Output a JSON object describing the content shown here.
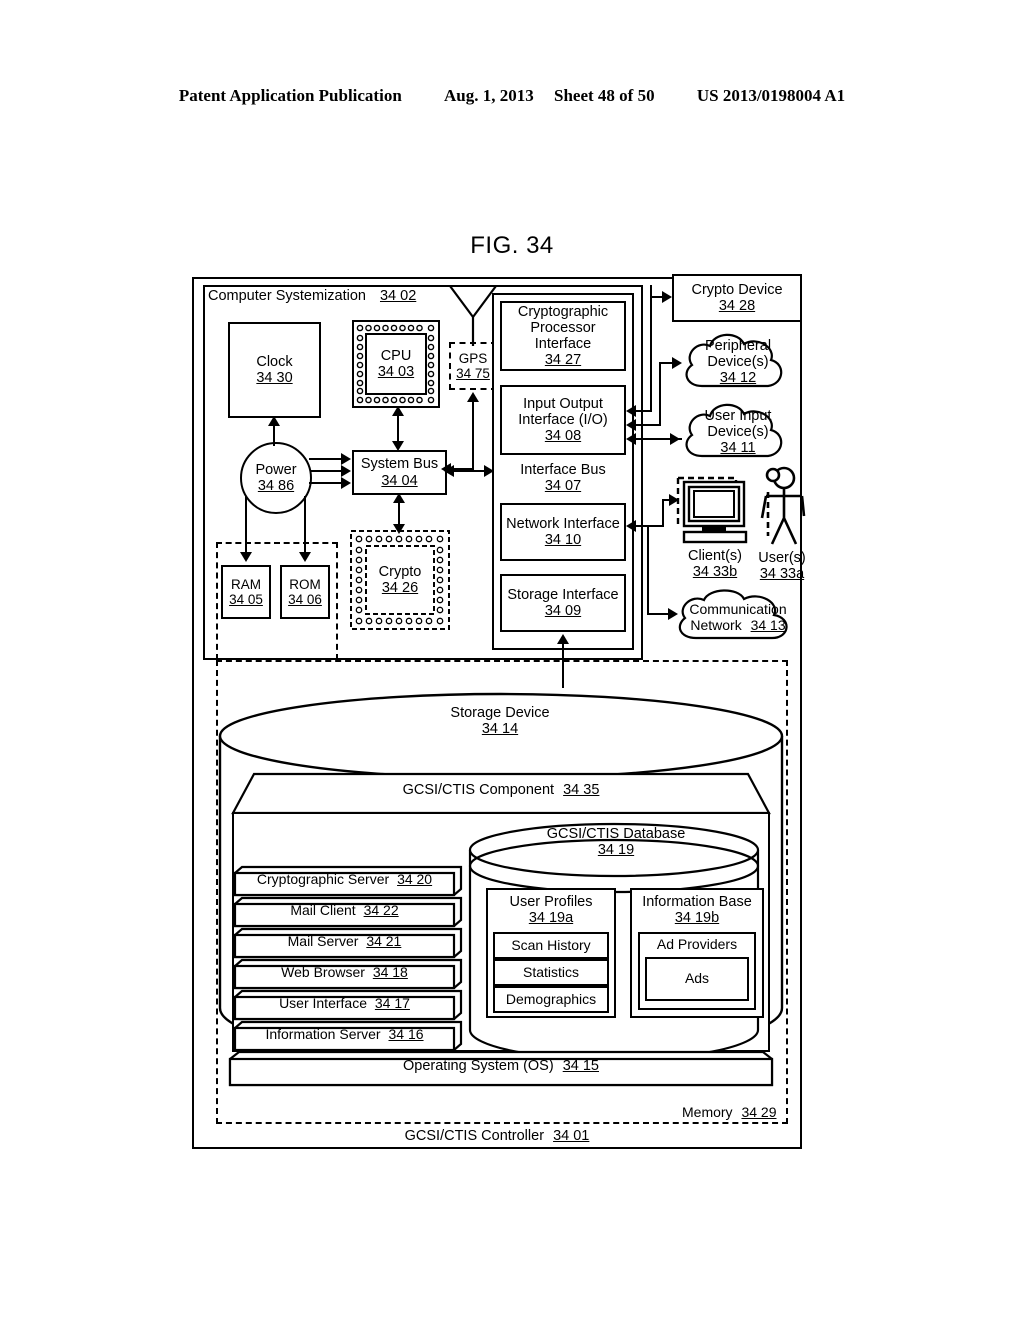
{
  "header": {
    "publication": "Patent Application Publication",
    "date": "Aug. 1, 2013",
    "sheet": "Sheet 48 of 50",
    "patent_number": "US 2013/0198004 A1"
  },
  "figure": {
    "title": "FIG. 34"
  },
  "diagram": {
    "outer_label": "GCSI/CTIS Controller",
    "outer_ref": "34 01",
    "systemization": {
      "label": "Computer Systemization",
      "ref": "34 02"
    },
    "clock": {
      "label": "Clock",
      "ref": "34 30"
    },
    "cpu": {
      "label": "CPU",
      "ref": "34 03"
    },
    "gps": {
      "label": "GPS",
      "ref": "34 75"
    },
    "power": {
      "label": "Power",
      "ref": "34 86"
    },
    "sysbus": {
      "label": "System Bus",
      "ref": "34 04"
    },
    "ram": {
      "label": "RAM",
      "ref": "34 05"
    },
    "rom": {
      "label": "ROM",
      "ref": "34 06"
    },
    "crypto_chip": {
      "label": "Crypto",
      "ref": "34 26"
    },
    "crypto_proc_interface": {
      "line1": "Cryptographic",
      "line2": "Processor Interface",
      "ref": "34 27"
    },
    "io_interface": {
      "line1": "Input Output",
      "line2": "Interface (I/O)",
      "ref": "34 08"
    },
    "interface_bus": {
      "label": "Interface Bus",
      "ref": "34 07"
    },
    "network_interface": {
      "label": "Network Interface",
      "ref": "34 10"
    },
    "storage_interface": {
      "label": "Storage Interface",
      "ref": "34 09"
    },
    "crypto_device": {
      "label": "Crypto Device",
      "ref": "34 28"
    },
    "peripheral": {
      "line1": "Peripheral",
      "line2": "Device(s)",
      "ref": "34 12"
    },
    "user_input": {
      "line1": "User Input",
      "line2": "Device(s)",
      "ref": "34 11"
    },
    "clients": {
      "label": "Client(s)",
      "ref": "34 33b"
    },
    "users": {
      "label": "User(s)",
      "ref": "34 33a"
    },
    "comm_network": {
      "line1": "Communication",
      "line2": "Network",
      "ref": "34 13"
    },
    "storage_device": {
      "label": "Storage Device",
      "ref": "34 14"
    },
    "memory": {
      "label": "Memory",
      "ref": "34 29"
    },
    "component": {
      "label": "GCSI/CTIS Component",
      "ref": "34 35"
    },
    "database": {
      "label": "GCSI/CTIS Database",
      "ref": "34 19"
    },
    "user_profiles": {
      "label": "User Profiles",
      "ref": "34 19a",
      "items": [
        "Scan History",
        "Statistics",
        "Demographics"
      ]
    },
    "information_base": {
      "label": "Information Base",
      "ref": "34 19b",
      "sub": "Ad Providers",
      "sub_item": "Ads"
    },
    "component_modules": [
      {
        "label": "Cryptographic Server",
        "ref": "34 20"
      },
      {
        "label": "Mail Client",
        "ref": "34 22"
      },
      {
        "label": "Mail Server",
        "ref": "34 21"
      },
      {
        "label": "Web Browser",
        "ref": "34 18"
      },
      {
        "label": "User Interface",
        "ref": "34 17"
      },
      {
        "label": "Information Server",
        "ref": "34 16"
      }
    ],
    "operating_system": {
      "label": "Operating System (OS)",
      "ref": "34 15"
    }
  },
  "colors": {
    "ink": "#000000",
    "paper": "#ffffff"
  }
}
